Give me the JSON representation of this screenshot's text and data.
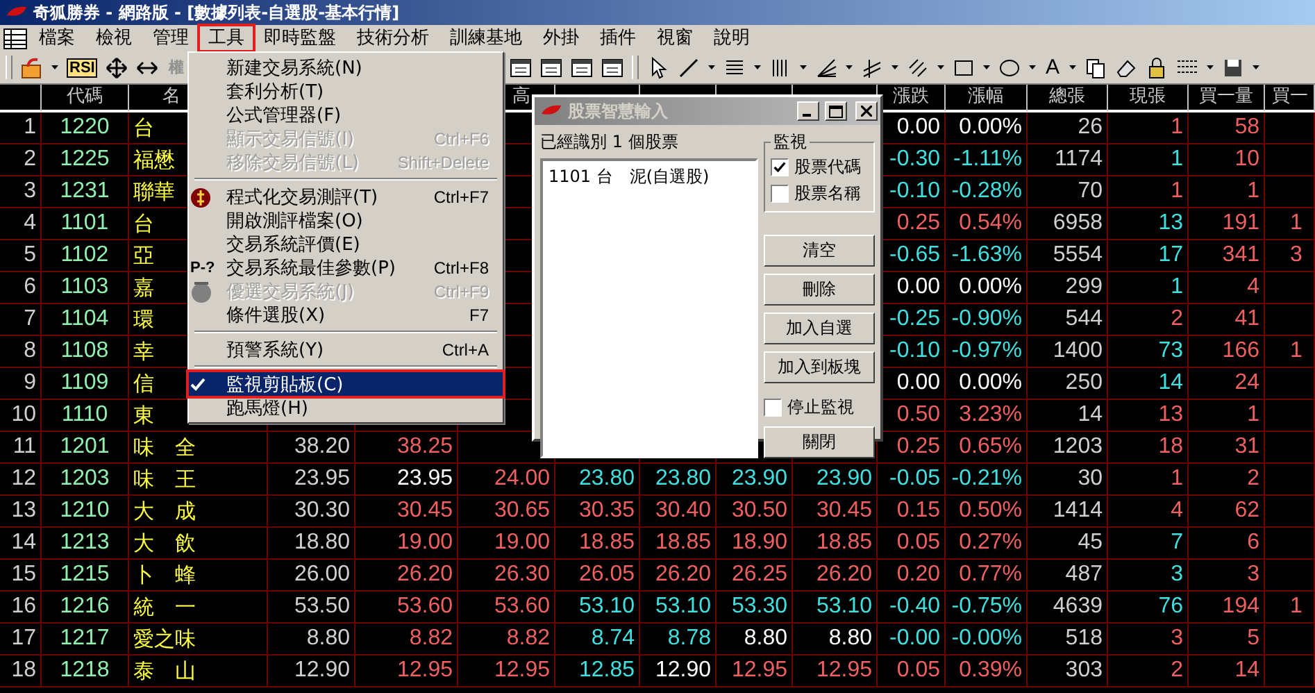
{
  "window": {
    "title": "奇狐勝券 - 網路版 - [數據列表-自選股-基本行情]"
  },
  "menu_bar": [
    {
      "label": "檔案",
      "selected": false,
      "annotated": false
    },
    {
      "label": "檢視",
      "selected": false,
      "annotated": false
    },
    {
      "label": "管理",
      "selected": false,
      "annotated": false
    },
    {
      "label": "工具",
      "selected": true,
      "annotated": true
    },
    {
      "label": "即時監盤",
      "selected": false,
      "annotated": false
    },
    {
      "label": "技術分析",
      "selected": false,
      "annotated": false
    },
    {
      "label": "訓練基地",
      "selected": false,
      "annotated": false
    },
    {
      "label": "外掛",
      "selected": false,
      "annotated": false
    },
    {
      "label": "插件",
      "selected": false,
      "annotated": false
    },
    {
      "label": "視窗",
      "selected": false,
      "annotated": false
    },
    {
      "label": "說明",
      "selected": false,
      "annotated": false
    }
  ],
  "toolbar": {
    "indicator_label": "RSI",
    "weight_label": "權",
    "text_tool_label": "A"
  },
  "table": {
    "columns": [
      null,
      {
        "label": "代碼"
      },
      {
        "label": "名",
        "cut_right": true
      },
      null,
      null,
      {
        "label": "高",
        "cut_left": true
      },
      null,
      null,
      null,
      null,
      {
        "label": "漲跌"
      },
      {
        "label": "漲幅"
      },
      {
        "label": "總張"
      },
      {
        "label": "現張"
      },
      {
        "label": "買一量"
      },
      {
        "label": "買一",
        "cut_right": true
      }
    ],
    "rows": [
      {
        "index": "1",
        "code": "1220",
        "name": "台",
        "change": "0.00",
        "change_pct": "0.00%",
        "volume": "26",
        "tick_volume": "1",
        "uptick": true,
        "bid_volume": "58"
      },
      {
        "index": "2",
        "code": "1225",
        "name": "福懋",
        "change": "-0.30",
        "change_pct": "-1.11%",
        "volume": "1174",
        "tick_volume": "1",
        "uptick": false,
        "bid_volume": "10"
      },
      {
        "index": "3",
        "code": "1231",
        "name": "聯華",
        "change": "-0.10",
        "change_pct": "-0.28%",
        "volume": "70",
        "tick_volume": "1",
        "uptick": true,
        "bid_volume": "1"
      },
      {
        "index": "4",
        "code": "1101",
        "name": "台",
        "change": "0.25",
        "change_pct": "0.54%",
        "volume": "6958",
        "tick_volume": "13",
        "uptick": false,
        "bid_volume": "191",
        "column_16": "1"
      },
      {
        "index": "5",
        "code": "1102",
        "name": "亞",
        "change": "-0.65",
        "change_pct": "-1.63%",
        "volume": "5554",
        "tick_volume": "17",
        "uptick": false,
        "bid_volume": "341",
        "column_16": "3"
      },
      {
        "index": "6",
        "code": "1103",
        "name": "嘉",
        "change": "0.00",
        "change_pct": "0.00%",
        "volume": "299",
        "tick_volume": "1",
        "uptick": false,
        "bid_volume": "4"
      },
      {
        "index": "7",
        "code": "1104",
        "name": "環",
        "change": "-0.25",
        "change_pct": "-0.90%",
        "volume": "544",
        "tick_volume": "2",
        "uptick": true,
        "bid_volume": "41"
      },
      {
        "index": "8",
        "code": "1108",
        "name": "幸",
        "change": "-0.10",
        "change_pct": "-0.97%",
        "volume": "1400",
        "tick_volume": "73",
        "uptick": false,
        "bid_volume": "166",
        "column_16": "1"
      },
      {
        "index": "9",
        "code": "1109",
        "name": "信",
        "change": "0.00",
        "change_pct": "0.00%",
        "volume": "250",
        "tick_volume": "14",
        "uptick": false,
        "bid_volume": "24"
      },
      {
        "index": "10",
        "code": "1110",
        "name": "東",
        "change": "0.50",
        "change_pct": "3.23%",
        "volume": "14",
        "tick_volume": "13",
        "uptick": true,
        "bid_volume": "1"
      },
      {
        "index": "11",
        "code": "1201",
        "name": "味　全",
        "prices": [
          "38.20",
          "38.25"
        ],
        "change": "0.25",
        "change_pct": "0.65%",
        "volume": "1203",
        "tick_volume": "18",
        "uptick": true,
        "bid_volume": "31"
      },
      {
        "index": "12",
        "code": "1203",
        "name": "味　王",
        "prices": [
          "23.95",
          "23.95",
          "24.00",
          "23.80",
          "23.80",
          "23.90",
          "23.90"
        ],
        "change": "-0.05",
        "change_pct": "-0.21%",
        "volume": "30",
        "tick_volume": "1",
        "uptick": true,
        "bid_volume": "2"
      },
      {
        "index": "13",
        "code": "1210",
        "name": "大　成",
        "prices": [
          "30.30",
          "30.45",
          "30.65",
          "30.35",
          "30.40",
          "30.50",
          "30.45"
        ],
        "change": "0.15",
        "change_pct": "0.50%",
        "volume": "1414",
        "tick_volume": "4",
        "uptick": true,
        "bid_volume": "62"
      },
      {
        "index": "14",
        "code": "1213",
        "name": "大　飲",
        "prices": [
          "18.80",
          "19.00",
          "19.00",
          "18.85",
          "18.85",
          "18.90",
          "18.85"
        ],
        "change": "0.05",
        "change_pct": "0.27%",
        "volume": "45",
        "tick_volume": "7",
        "uptick": false,
        "bid_volume": "6"
      },
      {
        "index": "15",
        "code": "1215",
        "name": "卜　蜂",
        "prices": [
          "26.00",
          "26.20",
          "26.30",
          "26.05",
          "26.20",
          "26.25",
          "26.20"
        ],
        "change": "0.20",
        "change_pct": "0.77%",
        "volume": "487",
        "tick_volume": "3",
        "uptick": false,
        "bid_volume": "3"
      },
      {
        "index": "16",
        "code": "1216",
        "name": "統　一",
        "prices": [
          "53.50",
          "53.60",
          "53.60",
          "53.10",
          "53.10",
          "53.30",
          "53.10"
        ],
        "change": "-0.40",
        "change_pct": "-0.75%",
        "volume": "4639",
        "tick_volume": "76",
        "uptick": false,
        "bid_volume": "194",
        "column_16": "1"
      },
      {
        "index": "17",
        "code": "1217",
        "name": "愛之味",
        "prices": [
          "8.80",
          "8.82",
          "8.82",
          "8.74",
          "8.78",
          "8.80",
          "8.80"
        ],
        "change": "-0.00",
        "change_pct": "-0.00%",
        "volume": "518",
        "tick_volume": "3",
        "uptick": true,
        "bid_volume": "5"
      },
      {
        "index": "18",
        "code": "1218",
        "name": "泰　山",
        "prices": [
          "12.90",
          "12.95",
          "12.95",
          "12.85",
          "12.90",
          "12.95",
          "12.95"
        ],
        "change": "0.05",
        "change_pct": "0.39%",
        "volume": "303",
        "tick_volume": "2",
        "uptick": true,
        "bid_volume": "14"
      }
    ]
  },
  "tools_menu": {
    "items": [
      {
        "kind": "plain",
        "label": "新建交易系統(N)",
        "disabled": false,
        "checked": false,
        "selected": false
      },
      {
        "kind": "plain",
        "label": "套利分析(T)",
        "disabled": false,
        "checked": false,
        "selected": false
      },
      {
        "kind": "plain",
        "label": "公式管理器(F)",
        "disabled": false,
        "checked": false,
        "selected": false
      },
      {
        "kind": "plain",
        "label": "顯示交易信號(I)",
        "shortcut": "Ctrl+F6",
        "disabled": true,
        "checked": false,
        "selected": false
      },
      {
        "kind": "plain",
        "label": "移除交易信號(L)",
        "shortcut": "Shift+Delete",
        "disabled": true,
        "checked": false,
        "selected": false
      },
      {
        "kind": "separator"
      },
      {
        "kind": "coin",
        "label": "程式化交易測評(T)",
        "shortcut": "Ctrl+F7",
        "disabled": false,
        "checked": false,
        "selected": false
      },
      {
        "kind": "plain",
        "label": "開啟測評檔案(O)",
        "disabled": false,
        "checked": false,
        "selected": false
      },
      {
        "kind": "plain",
        "label": "交易系統評價(E)",
        "disabled": false,
        "checked": false,
        "selected": false
      },
      {
        "kind": "glyph",
        "icon_text": "P-?",
        "label": "交易系統最佳參數(P)",
        "shortcut": "Ctrl+F8",
        "disabled": false,
        "checked": false,
        "selected": false
      },
      {
        "kind": "disc",
        "label": "優選交易系統(J)",
        "shortcut": "Ctrl+F9",
        "disabled": true,
        "checked": false,
        "selected": false
      },
      {
        "kind": "plain",
        "label": "條件選股(X)",
        "shortcut": "F7",
        "disabled": false,
        "checked": false,
        "selected": false
      },
      {
        "kind": "separator"
      },
      {
        "kind": "plain",
        "label": "預警系統(Y)",
        "shortcut": "Ctrl+A",
        "disabled": false,
        "checked": false,
        "selected": false
      },
      {
        "kind": "separator"
      },
      {
        "kind": "plain",
        "label": "監視剪貼板(C)",
        "disabled": false,
        "checked": true,
        "selected": true,
        "annotated": true
      },
      {
        "kind": "plain",
        "label": "跑馬燈(H)",
        "disabled": false,
        "checked": false,
        "selected": false
      }
    ]
  },
  "dialog": {
    "title": "股票智慧輸入",
    "active": false,
    "status": "已經識別 1 個股票",
    "list": [
      "1101 台　泥(自選股)"
    ],
    "group": {
      "label": "監視",
      "options": [
        {
          "label": "股票代碼",
          "checked": true
        },
        {
          "label": "股票名稱",
          "checked": false
        }
      ]
    },
    "buttons": [
      "清空",
      "刪除",
      "加入自選",
      "加入到板塊"
    ],
    "stop_option": {
      "label": "停止監視",
      "checked": false
    },
    "close_button": "關閉"
  }
}
